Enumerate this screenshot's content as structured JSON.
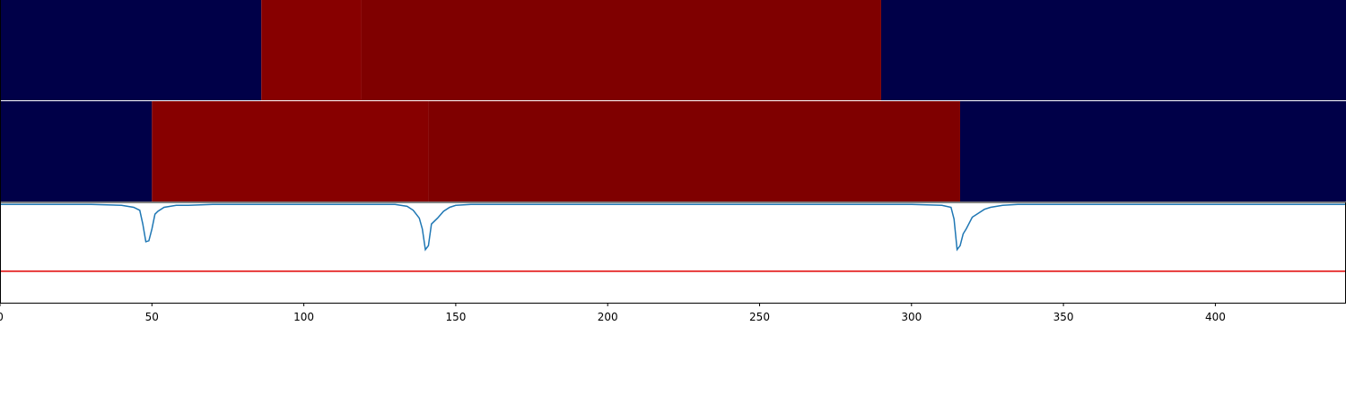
{
  "chart_data": {
    "type": "heatmap",
    "xlim": [
      0,
      443
    ],
    "x_ticks": [
      0,
      50,
      100,
      150,
      200,
      250,
      300,
      350,
      400
    ],
    "x_tick_labels": [
      "0",
      "50",
      "100",
      "150",
      "200",
      "250",
      "300",
      "350",
      "400"
    ],
    "colors": {
      "low": "#000048",
      "high_bright": "#870000",
      "high": "#7f0000",
      "trace": "#1f77b4",
      "threshold": "#e00000",
      "axis": "#000000"
    },
    "rows": [
      {
        "segments": [
          {
            "start": 0,
            "end": 86,
            "level": "low"
          },
          {
            "start": 86,
            "end": 119,
            "level": "high_bright"
          },
          {
            "start": 119,
            "end": 290,
            "level": "high"
          },
          {
            "start": 290,
            "end": 443,
            "level": "low"
          }
        ]
      },
      {
        "segments": [
          {
            "start": 0,
            "end": 50,
            "level": "low"
          },
          {
            "start": 50,
            "end": 141,
            "level": "high_bright"
          },
          {
            "start": 141,
            "end": 316,
            "level": "high"
          },
          {
            "start": 316,
            "end": 443,
            "level": "low"
          }
        ]
      }
    ],
    "line_panel": {
      "ylim": [
        -1.0,
        0.02
      ],
      "threshold": -0.68,
      "series": [
        {
          "x": [
            0,
            30,
            40,
            44,
            46,
            47,
            48,
            49,
            50,
            51,
            52,
            54,
            56,
            58,
            62,
            70,
            130,
            134,
            136,
            137,
            138,
            139,
            140,
            141,
            142,
            144,
            146,
            148,
            150,
            155,
            300,
            310,
            313,
            314,
            315,
            316,
            317,
            318,
            320,
            322,
            324,
            326,
            330,
            335,
            443
          ],
          "y": [
            0,
            0,
            -0.01,
            -0.03,
            -0.06,
            -0.2,
            -0.38,
            -0.37,
            -0.25,
            -0.1,
            -0.07,
            -0.03,
            -0.02,
            -0.01,
            -0.01,
            0,
            0,
            -0.02,
            -0.06,
            -0.1,
            -0.14,
            -0.25,
            -0.46,
            -0.42,
            -0.2,
            -0.14,
            -0.07,
            -0.03,
            -0.01,
            0,
            0,
            -0.01,
            -0.03,
            -0.15,
            -0.46,
            -0.42,
            -0.3,
            -0.25,
            -0.13,
            -0.09,
            -0.05,
            -0.03,
            -0.01,
            0,
            0
          ]
        }
      ]
    }
  }
}
